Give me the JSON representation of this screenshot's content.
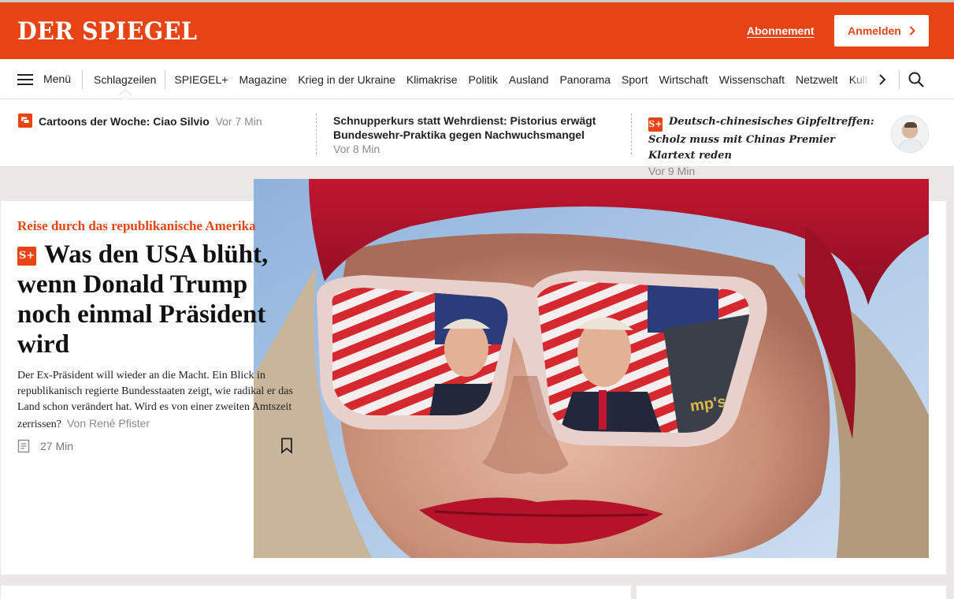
{
  "brand": {
    "logo": "DER SPIEGEL",
    "accent": "#e64415"
  },
  "header": {
    "subscription": "Abonnement",
    "login": "Anmelden"
  },
  "nav": {
    "menu_label": "Menü",
    "items": [
      "Schlagzeilen",
      "SPIEGEL+",
      "Magazine",
      "Krieg in der Ukraine",
      "Klimakrise",
      "Politik",
      "Ausland",
      "Panorama",
      "Sport",
      "Wirtschaft",
      "Wissenschaft",
      "Netzwelt",
      "Kultur"
    ],
    "icons": [
      "menu-icon",
      "chevron-right-icon",
      "search-icon"
    ]
  },
  "ticker": [
    {
      "title": "Cartoons der Woche: Ciao Silvio",
      "time": "Vor 7 Min",
      "icon": "chat-icon"
    },
    {
      "title": "Schnupperkurs statt Wehrdienst: Pistorius erwägt Bundeswehr-Praktika gegen Nachwuchsmangel",
      "time": "Vor 8 Min"
    },
    {
      "title": "Deutsch-chinesisches Gipfeltreffen: Scholz muss mit Chinas Premier Klartext reden",
      "time": "Vor 9 Min",
      "badge": "S+"
    }
  ],
  "lead": {
    "kicker": "Reise durch das republikanische Amerika",
    "badge": "S+",
    "headline": "Was den USA blüht, wenn Donald Trump noch einmal Präsident wird",
    "teaser": "Der Ex-Präsident will wieder an die Macht. Ein Blick in republikanisch regierte Bundesstaaten zeigt, wie radikal er das Land schon verändert hat. Wird es von einer zweiten Amtszeit zerrissen?",
    "author": "Von René Pfister",
    "reading_time": "27 Min",
    "photo_text": "mp's"
  }
}
